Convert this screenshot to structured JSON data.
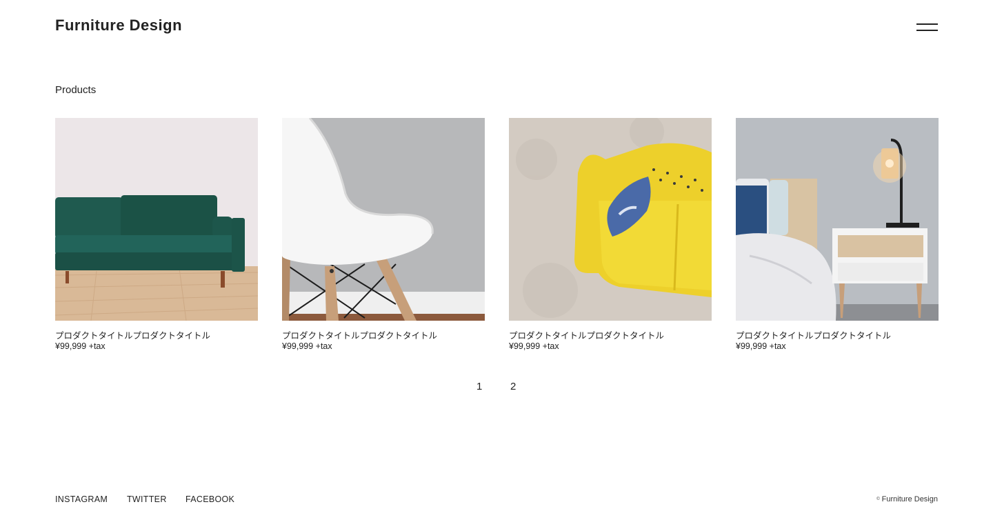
{
  "header": {
    "logo": "Furniture Design",
    "menu_icon": "hamburger-menu-icon"
  },
  "main": {
    "section_title": "Products",
    "products": [
      {
        "title": "プロダクトタイトルプロダクトタイトル",
        "price": "¥99,999 +tax",
        "image": "green-velvet-sofa"
      },
      {
        "title": "プロダクトタイトルプロダクトタイトル",
        "price": "¥99,999 +tax",
        "image": "white-shell-chair"
      },
      {
        "title": "プロダクトタイトルプロダクトタイトル",
        "price": "¥99,999 +tax",
        "image": "yellow-sofa-top-view"
      },
      {
        "title": "プロダクトタイトルプロダクトタイトル",
        "price": "¥99,999 +tax",
        "image": "bedroom-nightstand-lamp"
      }
    ]
  },
  "pagination": {
    "pages": [
      "1",
      "2"
    ]
  },
  "footer": {
    "links": [
      "INSTAGRAM",
      "TWITTER",
      "FACEBOOK"
    ],
    "copyright_symbol": "©",
    "copyright_text": "Furniture Design"
  }
}
